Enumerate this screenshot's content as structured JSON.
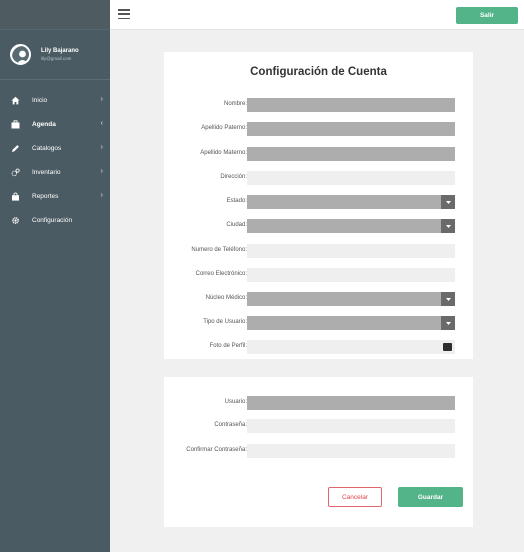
{
  "user": {
    "name": "Lily Bajarano",
    "email": "lily@gmail.com"
  },
  "nav": [
    {
      "label": "Inicio",
      "icon": "home-icon",
      "chevron": "›",
      "active": false
    },
    {
      "label": "Agenda",
      "icon": "briefcase-icon",
      "chevron": "‹",
      "active": true
    },
    {
      "label": "Catalogos",
      "icon": "pencil-icon",
      "chevron": "›",
      "active": false
    },
    {
      "label": "Inventario",
      "icon": "gears-icon",
      "chevron": "›",
      "active": false
    },
    {
      "label": "Reportes",
      "icon": "bag-icon",
      "chevron": "›",
      "active": false
    },
    {
      "label": "Configuración",
      "icon": "gear-icon",
      "chevron": "",
      "active": false
    }
  ],
  "topbar": {
    "logout_label": "Salir"
  },
  "form": {
    "title": "Configuración de Cuenta",
    "fields": {
      "nombre": "Nombre:",
      "apellido_paterno": "Apellido Paterno:",
      "apellido_materno": "Apellido Materno:",
      "direccion": "Dirección:",
      "estado": "Estado:",
      "ciudad": "Ciudad:",
      "telefono": "Numero de Teléfono:",
      "correo": "Correo Electrónico:",
      "nucleo": "Núcleo Médico:",
      "tipo_usuario": "Tipo de Usuario:",
      "foto": "Foto de Perfil:"
    }
  },
  "account": {
    "fields": {
      "usuario": "Usuario:",
      "contrasena": "Contraseña:",
      "confirmar": "Confirmar Contraseña:"
    },
    "cancel_label": "Cancelar",
    "save_label": "Guardar"
  },
  "colors": {
    "sidebar": "#4a5b63",
    "accent": "#52b488",
    "cancel": "#e0434d"
  }
}
